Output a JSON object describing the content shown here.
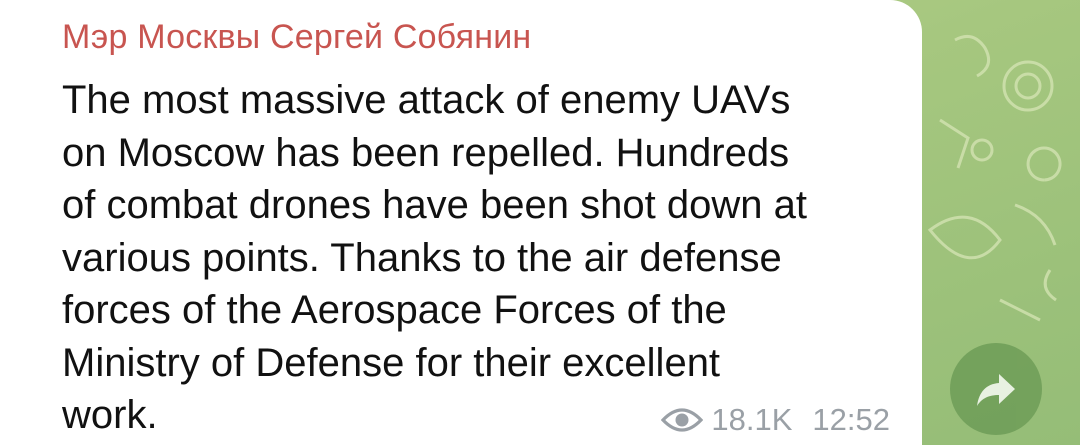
{
  "message": {
    "sender": "Мэр Москвы Сергей Собянин",
    "lines": [
      "The most massive attack of enemy UAVs",
      "on Moscow has been repelled. Hundreds",
      "of combat drones have been shot down at",
      "various points. Thanks to the air defense",
      "forces of the Aerospace Forces of the",
      "Ministry of Defense for their excellent",
      "work."
    ],
    "views": "18.1K",
    "time": "12:52",
    "views_icon": "eye-icon"
  },
  "actions": {
    "share_icon": "forward-arrow-icon"
  },
  "colors": {
    "sender": "#c85550",
    "bubble": "#ffffff",
    "background": "#a6c77f",
    "share_button": "#6a9a55",
    "meta": "#9aa0a6"
  }
}
